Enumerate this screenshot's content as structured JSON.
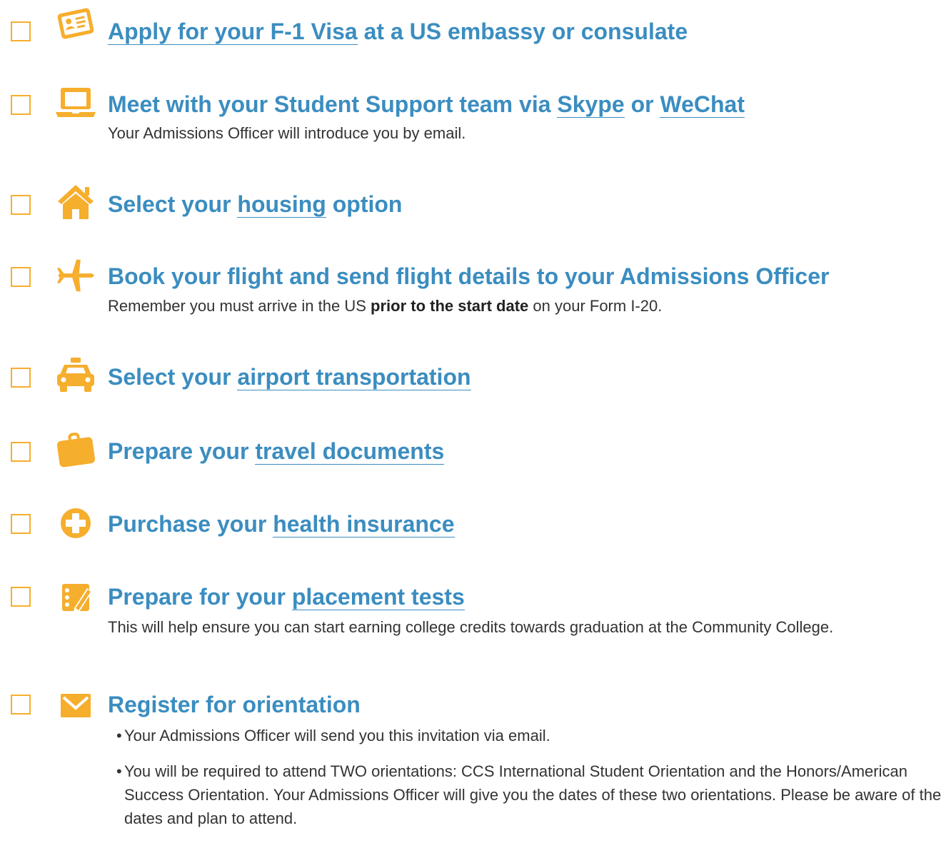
{
  "colors": {
    "accent": "#f6ae2d",
    "title": "#3b8dc0",
    "body": "#333333"
  },
  "items": [
    {
      "icon": "id-card-icon",
      "title_pre": "",
      "link1": "Apply for your F-1 Visa",
      "title_mid": " at a US embassy or consulate",
      "link2": "",
      "title_post": ""
    },
    {
      "icon": "laptop-icon",
      "title_pre": "Meet with your Student Support team via ",
      "link1": "Skype",
      "title_mid": " or ",
      "link2": "WeChat",
      "title_post": "",
      "desc": "Your Admissions Officer will introduce you by email."
    },
    {
      "icon": "house-icon",
      "title_pre": "Select your ",
      "link1": "housing",
      "title_mid": " option"
    },
    {
      "icon": "airplane-icon",
      "title": "Book your flight and send flight details to your Admissions Officer",
      "desc_pre": "Remember you must arrive in the US ",
      "desc_bold": "prior to the start date",
      "desc_post": " on your Form I-20."
    },
    {
      "icon": "taxi-icon",
      "title_pre": "Select your ",
      "link1": "airport transportation",
      "title_mid": ""
    },
    {
      "icon": "briefcase-icon",
      "title_pre": "Prepare your ",
      "link1": "travel documents",
      "title_mid": ""
    },
    {
      "icon": "medical-cross-icon",
      "title_pre": "Purchase your ",
      "link1": "health insurance",
      "title_mid": ""
    },
    {
      "icon": "checklist-pencil-icon",
      "title_pre": "Prepare for your ",
      "link1": "placement tests ",
      "title_mid": "",
      "desc": "This will help ensure you can start earning college credits towards graduation at the Community College."
    },
    {
      "icon": "envelope-icon",
      "title": "Register for orientation",
      "bullets": [
        "Your Admissions Officer will send you this invitation via email.",
        "You will be required to attend TWO orientations: CCS International Student Orientation and the Honors/American Success Orientation. Your Admissions Officer will give you the dates of these two orientations. Please be aware of the dates and plan to attend."
      ]
    }
  ]
}
